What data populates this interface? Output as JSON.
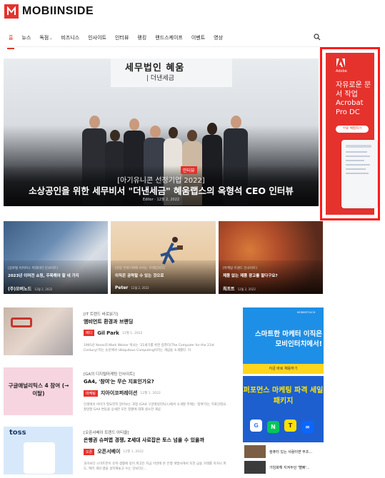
{
  "site": {
    "logo_text": "MOBIINSIDE"
  },
  "nav": {
    "items": [
      "홈",
      "뉴스",
      "독점",
      "비즈니스",
      "인사이트",
      "인터뷰",
      "랭킹",
      "랜드스케이프",
      "이벤트",
      "영상"
    ],
    "caret": "⌄"
  },
  "hero": {
    "sign": "세무법인 혜움",
    "sign2": "| 더낸세금",
    "tag": "인터뷰",
    "category": "[아기유니콘 선정기업 2022]",
    "title": "소상공인을 위한 세무비서 \"더낸세금\" 혜움랩스의 옥형석 CEO 인터뷰",
    "author": "Editor",
    "date": "12월 2, 2022"
  },
  "ad_adobe": {
    "brand": "Adobe",
    "text": "자유로운 문서 작업 Acrobat Pro DC",
    "button": "무료 체험하기"
  },
  "cards": [
    {
      "category": "[글로벌 이커머스 빅데이터 인사이트]",
      "title": "2023년 이머전 쇼핑, 주목해야 할 네 가지",
      "author": "(주)오버노드",
      "date": "12월 2, 2022"
    },
    {
      "category": "[현장 전략기획에 쓰이는 프레임워크]",
      "title": "이직은 공략할 수 있는 것으로",
      "author": "Peter",
      "date": "12월 2, 2022"
    },
    {
      "category": "[마케팅 트렌드 인사이트]",
      "title": "제품 없는 제품 광고를 팔다구요?",
      "author": "최프트",
      "date": "12월 2, 2022"
    }
  ],
  "list": [
    {
      "category": "[IT 트렌드 바로읽기]",
      "title": "앰비언트 환경과 브랜딩",
      "badge": "에디",
      "author": "Gil Park",
      "date": "12월 1, 2022",
      "desc": "1991년 Xerox의 Mark Weiser 박사는 '21세기를 위한 컴퓨터(The Computer for the 21st Century)'라는 논문에서 Ubiquitous Computing이라는 개념을 소개했다. 이",
      "thumb_text": ""
    },
    {
      "category": "[GA의 디지털마케팅 인사이트]",
      "title": "GA4, '참여'는 무슨 지표인가요?",
      "badge": "마케팅",
      "author": "지아이코퍼레이션",
      "date": "12월 1, 2022",
      "desc": "인생에서 비어가 필요한지 알아보는 과정 (GA4 구글애널리틱스)에서 소개할 주제는 '참여'라는 지표인데요. 잘알잘 GA4 변동을 상세한 모든 정황에 대해 생소한 개념",
      "thumb_text": "구글애널리틱스 4 참여 (→ 이탈)"
    },
    {
      "category": "[오픈서베이 트렌드 아티클]",
      "title": "은행권 슈퍼앱 경쟁, Z세대 사로잡은 토스 넘을 수 있을까",
      "badge": "오픈",
      "author": "오픈서베이",
      "date": "12월 1, 2022",
      "desc": "과거보다 스마트폰이 유져 생활에 깊이 파고든 지금 이번에 온 은행 개발사에서 또한 금융 거래를 하거나 퍼도, 여러 개의 앱을 설치해놓고 쓰는 것보다는...",
      "thumb_text": "toss"
    }
  ],
  "ad_mobi": {
    "brand": "MOBIINTOUCH",
    "text": "스마트한 마케터 이직은 모비인터치에서!",
    "strip": "지금 바로 채용하기"
  },
  "ad_perf": {
    "text": "퍼포먼스 마케팅 파격 세일 패키지",
    "icons": [
      "G",
      "N",
      "T",
      "∞"
    ]
  },
  "side_news": [
    {
      "text": "컴퓨터 있는 사람이면 무조..."
    },
    {
      "text": "가임화해 지켜두던 '빨빠'..."
    }
  ],
  "colors": {
    "accent": "#e5322d",
    "ad_highlight": "#ff1a1a"
  }
}
